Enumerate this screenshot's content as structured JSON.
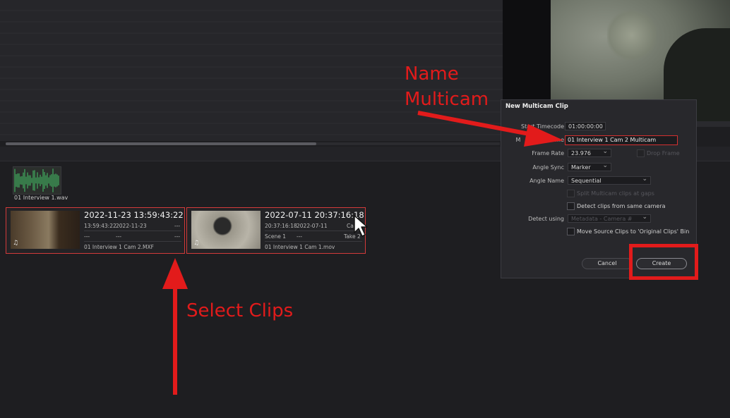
{
  "audio_clip": {
    "label": "01 Interview 1.wav"
  },
  "clips": [
    {
      "title": "2022-11-23  13:59:43:22",
      "row1a": "13:59:43:22",
      "row1b": "2022-11-23",
      "row1c": "---",
      "row2a": "---",
      "row2b": "---",
      "row2c": "---",
      "filename": "01 Interview 1 Cam 2.MXF"
    },
    {
      "title": "2022-07-11  20:37:16:18",
      "row1a": "20:37:16:18",
      "row1b": "2022-07-11",
      "row1c": "Cam",
      "row2a": "Scene 1",
      "row2b": "---",
      "row2c": "Take 2",
      "filename": "01 Interview 1 Cam 1.mov"
    }
  ],
  "dialog": {
    "title": "New Multicam Clip",
    "start_timecode_label": "Start Timecode",
    "start_timecode_value": "01:00:00:00",
    "name_label_prefix": "M",
    "name_label_suffix": "Name",
    "name_value": "01 Interview 1 Cam 2 Multicam",
    "frame_rate_label": "Frame Rate",
    "frame_rate_value": "23.976",
    "drop_frame_label": "Drop Frame",
    "angle_sync_label": "Angle Sync",
    "angle_sync_value": "Marker",
    "angle_name_label": "Angle Name",
    "angle_name_value": "Sequential",
    "split_label": "Split Multicam clips at gaps",
    "detect_same_camera_label": "Detect clips from same camera",
    "detect_using_label": "Detect using",
    "detect_using_value": "Metadata - Camera #",
    "move_source_label": "Move Source Clips to 'Original Clips' Bin",
    "cancel_label": "Cancel",
    "create_label": "Create"
  },
  "annotations": {
    "name_line1": "Name",
    "name_line2": "Multicam",
    "select_clips": "Select Clips",
    "color": "#e21b1b"
  }
}
